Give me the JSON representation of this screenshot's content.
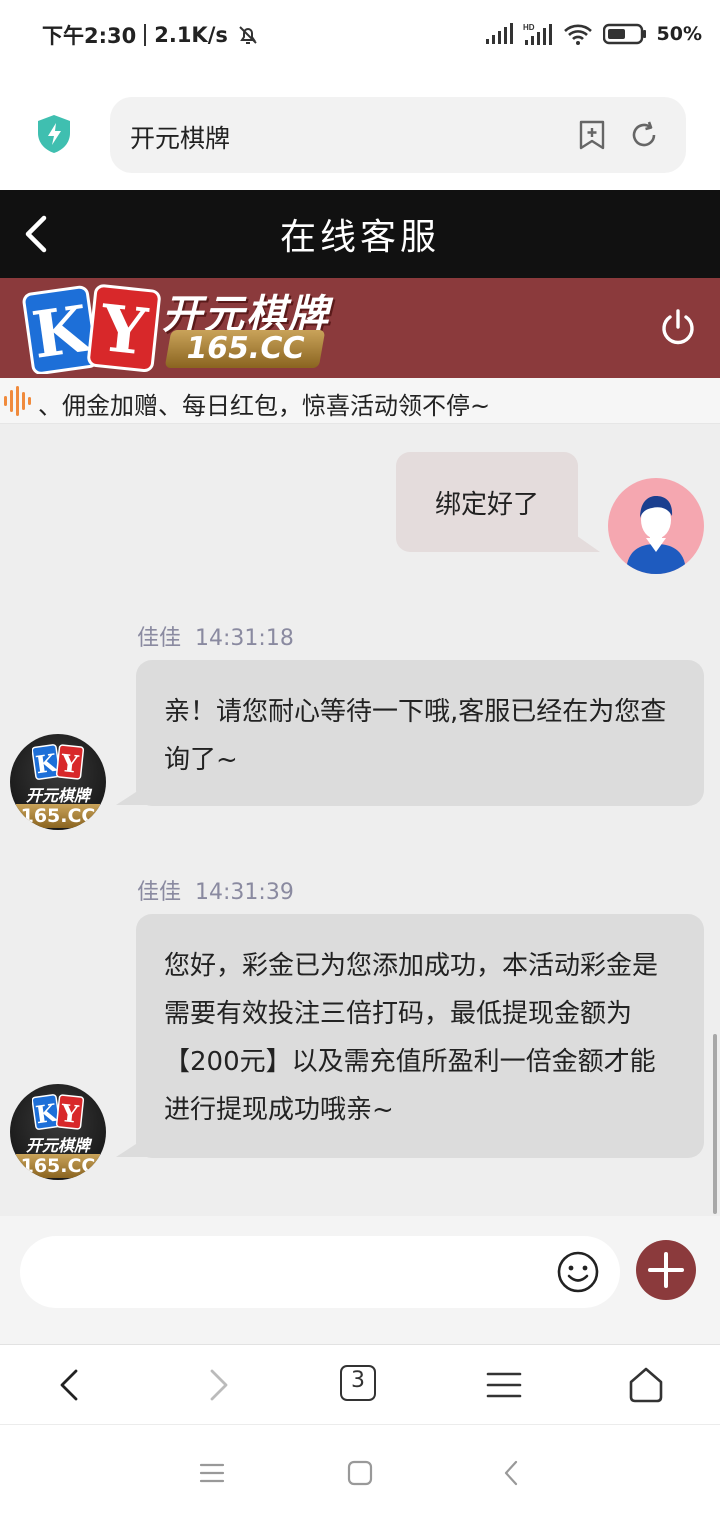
{
  "status_bar": {
    "time": "下午2:30",
    "net_speed": "2.1K/s",
    "battery": "50%",
    "icons": [
      "bell-off-icon",
      "signal-icon",
      "hd-signal-icon",
      "wifi-icon",
      "battery-icon"
    ]
  },
  "browser": {
    "url_title": "开元棋牌",
    "icons": [
      "shield-icon",
      "bookmark-add-icon",
      "refresh-icon"
    ]
  },
  "header": {
    "title": "在线客服",
    "back_icon": "chevron-left-icon"
  },
  "banner": {
    "logo_letters": "KY",
    "brand_name": "开元棋牌",
    "domain": "165.CC",
    "power_icon": "power-icon",
    "color": "#8b3a3c"
  },
  "marquee": {
    "text": "、佣金加赠、每日红包，惊喜活动领不停~"
  },
  "messages": [
    {
      "direction": "out",
      "text": "绑定好了"
    },
    {
      "direction": "in",
      "sender": "佳佳",
      "time": "14:31:18",
      "text": "亲！请您耐心等待一下哦,客服已经在为您查询了~"
    },
    {
      "direction": "in",
      "sender": "佳佳",
      "time": "14:31:39",
      "text": "您好，彩金已为您添加成功，本活动彩金是需要有效投注三倍打码，最低提现金额为【200元】以及需充值所盈利一倍金额才能进行提现成功哦亲~"
    }
  ],
  "cs_avatar": {
    "letters": "KY",
    "name": "开元棋牌",
    "domain": "165.CC"
  },
  "input": {
    "placeholder": "",
    "emoji_icon": "smiley-icon",
    "plus_icon": "plus-icon"
  },
  "browser_nav": {
    "tab_count": "3",
    "icons": [
      "back-icon",
      "forward-icon",
      "tabs-icon",
      "menu-icon",
      "home-icon"
    ]
  },
  "system_nav": {
    "icons": [
      "recents-icon",
      "home-square-icon",
      "system-back-icon"
    ]
  },
  "colors": {
    "accent": "#8b3a3c",
    "header_bg": "#111111",
    "chat_bg": "#eeeeee",
    "bubble_in": "#dcdcdc",
    "bubble_out": "#e4dcdc",
    "meta_text": "#8a8aa0"
  }
}
